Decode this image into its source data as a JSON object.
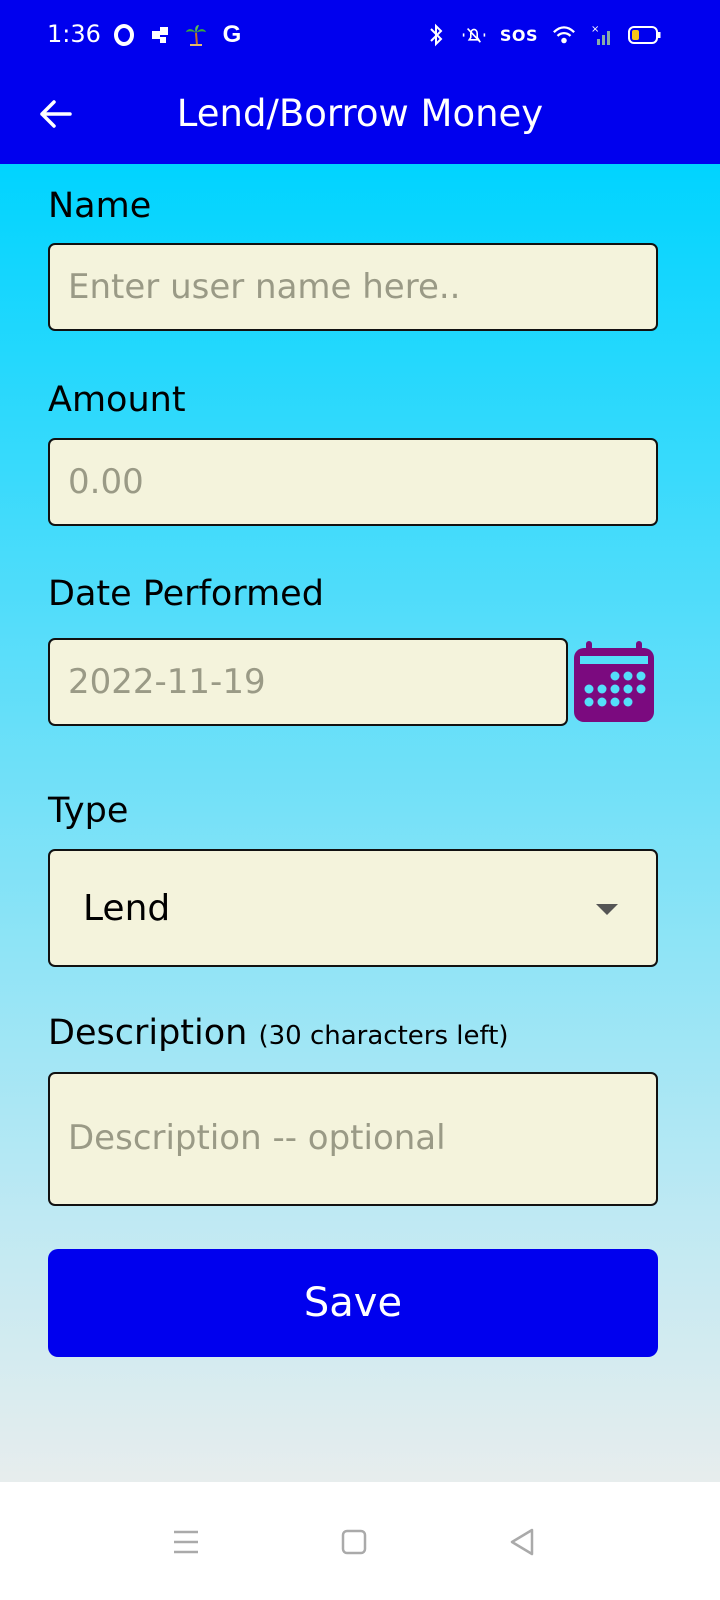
{
  "status_bar": {
    "time": "1:36",
    "left_icons": [
      "opera-icon",
      "app-icon",
      "palm-tree-icon",
      "google-icon"
    ],
    "google_letter": "G",
    "right_icons": [
      "bluetooth-icon",
      "muted-icon",
      "sos-icon",
      "wifi-icon",
      "no-signal-icon",
      "battery-icon"
    ],
    "sos": "SOS"
  },
  "app_bar": {
    "title": "Lend/Borrow Money",
    "back_icon": "back-arrow-icon"
  },
  "form": {
    "name": {
      "label": "Name",
      "placeholder": "Enter user name here..",
      "value": ""
    },
    "amount": {
      "label": "Amount",
      "placeholder": "0.00",
      "value": ""
    },
    "date": {
      "label": "Date Performed",
      "placeholder": "2022-11-19",
      "value": "",
      "icon": "calendar-icon"
    },
    "type": {
      "label": "Type",
      "selected": "Lend"
    },
    "description": {
      "label": "Description",
      "counter": "(30 characters left)",
      "placeholder": "Description -- optional",
      "value": ""
    },
    "save_label": "Save"
  },
  "nav_bar": {
    "items": [
      "menu-icon",
      "home-icon",
      "back-icon"
    ]
  },
  "colors": {
    "primary": "#0000ee",
    "field_bg": "#f4f3dc",
    "gradient_top": "#00d4ff",
    "gradient_bottom": "#e7eded",
    "calendar": "#7b0a7f"
  }
}
